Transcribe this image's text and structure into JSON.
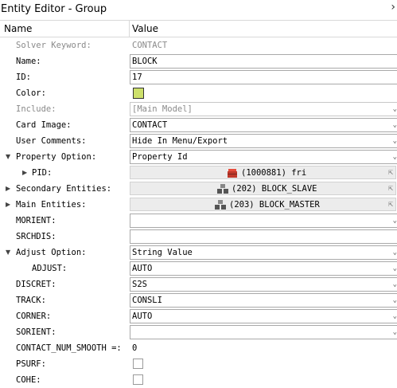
{
  "window": {
    "title": "Entity Editor - Group",
    "close_icon": "collapse-chevron-icon"
  },
  "table": {
    "col_name": "Name",
    "col_value": "Value"
  },
  "rows": {
    "solver_keyword": {
      "label": "Solver Keyword:",
      "value": "CONTACT"
    },
    "name": {
      "label": "Name:",
      "value": "BLOCK"
    },
    "id": {
      "label": "ID:",
      "value": "17"
    },
    "color": {
      "label": "Color:",
      "swatch": "#cde06b"
    },
    "include": {
      "label": "Include:",
      "value": "[Main Model]"
    },
    "card_image": {
      "label": "Card Image:",
      "value": "CONTACT"
    },
    "user_comments": {
      "label": "User Comments:",
      "value": "Hide In Menu/Export"
    },
    "property_option": {
      "label": "Property Option:",
      "value": "Property Id"
    },
    "pid": {
      "label": "PID:",
      "value": "(1000881) fri"
    },
    "secondary_entities": {
      "label": "Secondary Entities:",
      "value": "(202) BLOCK_SLAVE"
    },
    "main_entities": {
      "label": "Main Entities:",
      "value": "(203) BLOCK_MASTER"
    },
    "morient": {
      "label": "MORIENT:",
      "value": ""
    },
    "srchdis": {
      "label": "SRCHDIS:",
      "value": ""
    },
    "adjust_option": {
      "label": "Adjust Option:",
      "value": "String Value"
    },
    "adjust": {
      "label": "ADJUST:",
      "value": "AUTO"
    },
    "discret": {
      "label": "DISCRET:",
      "value": "S2S"
    },
    "track": {
      "label": "TRACK:",
      "value": "CONSLI"
    },
    "corner": {
      "label": "CORNER:",
      "value": "AUTO"
    },
    "sorient": {
      "label": "SORIENT:",
      "value": ""
    },
    "contact_num_smooth": {
      "label": "CONTACT_NUM_SMOOTH =:",
      "value": "0"
    },
    "psurf": {
      "label": "PSURF:",
      "checked": false
    },
    "cohe": {
      "label": "COHE:",
      "checked": false
    }
  }
}
